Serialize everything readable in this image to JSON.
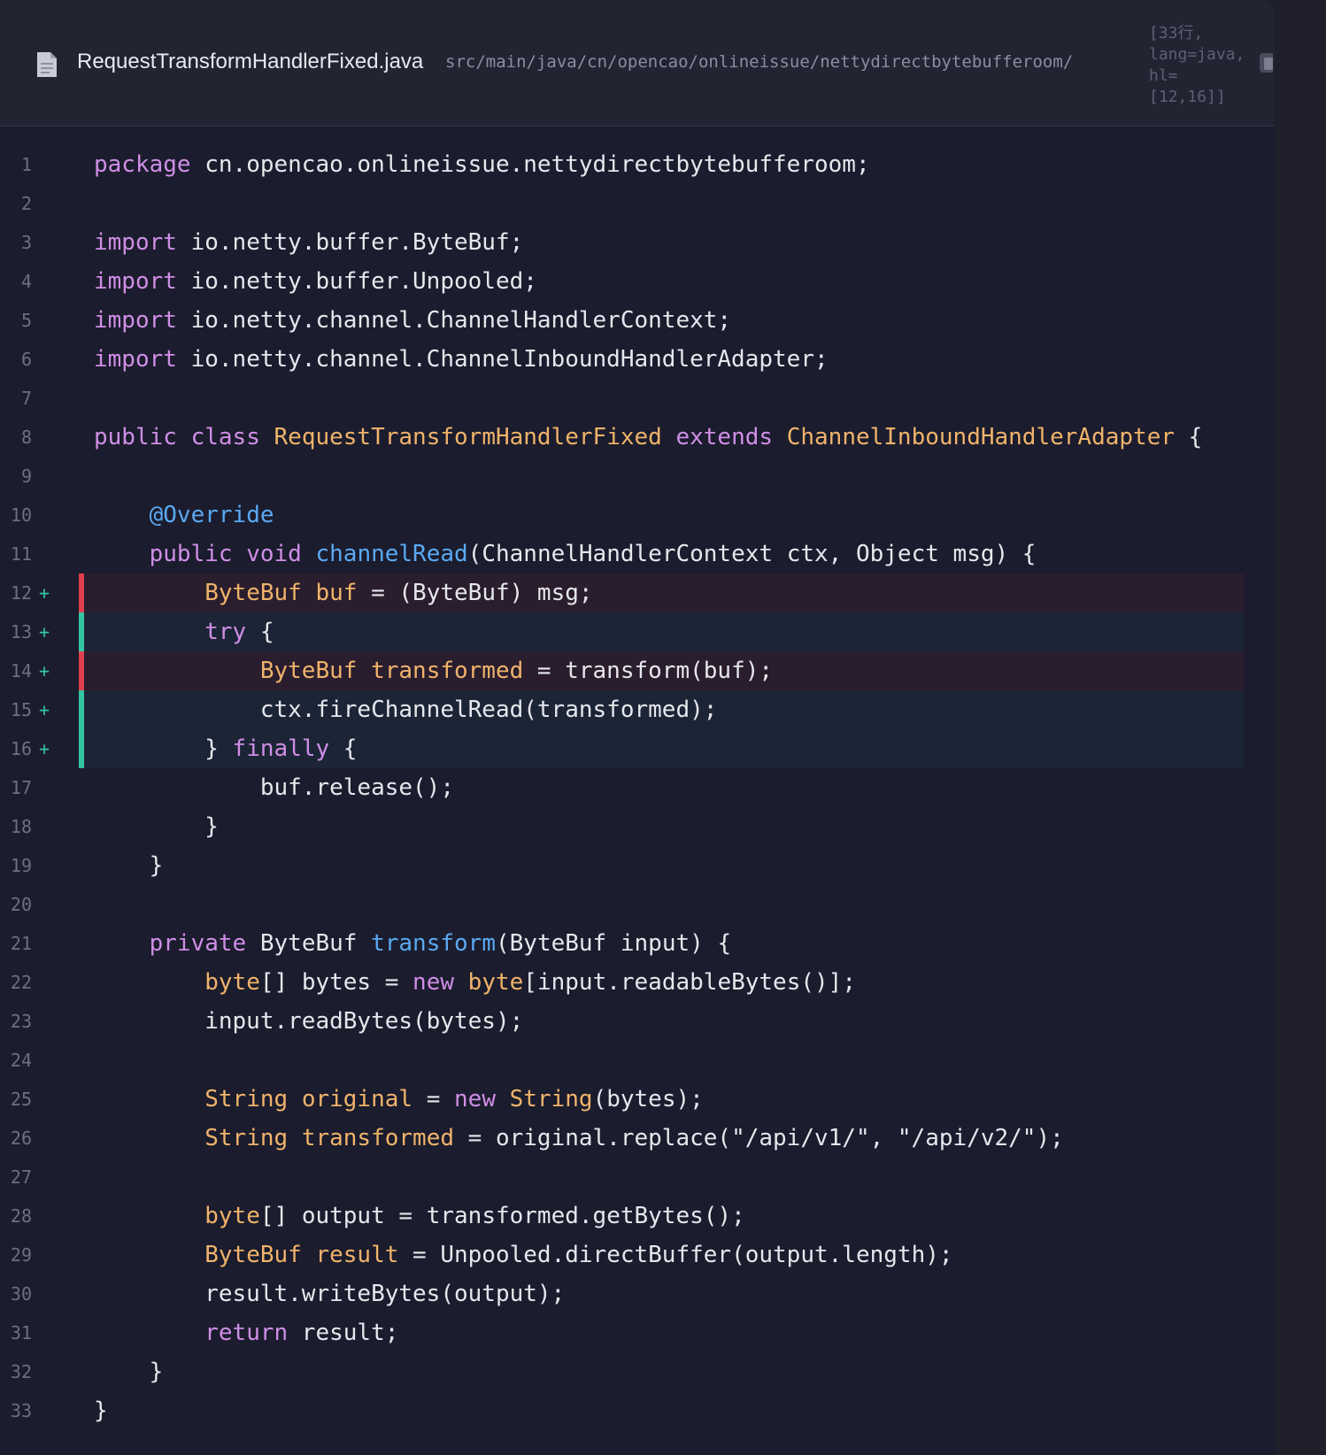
{
  "header": {
    "file_name": "RequestTransformHandlerFixed.java",
    "file_path": "src/main/java/cn/opencao/onlineissue/nettydirectbytebufferoom/",
    "meta": "[33行,\nlang=java,\nhl=\n[12,16]]",
    "file_icon": "document-icon",
    "copy_icon": "copy-icon"
  },
  "colors": {
    "keyword": "#cf8ee6",
    "type": "#f0b36b",
    "function": "#5aa9f2",
    "text": "#e6e7ec",
    "added_red": "#e0404d",
    "added_teal": "#35c4a2"
  },
  "lines": [
    {
      "n": "1",
      "mark": "",
      "hl": "",
      "tokens": [
        [
          "kw",
          "package"
        ],
        [
          "pl",
          " cn.opencao.onlineissue.nettydirectbytebufferoom;"
        ]
      ]
    },
    {
      "n": "2",
      "mark": "",
      "hl": "",
      "tokens": []
    },
    {
      "n": "3",
      "mark": "",
      "hl": "",
      "tokens": [
        [
          "kw",
          "import"
        ],
        [
          "pl",
          " io.netty.buffer.ByteBuf;"
        ]
      ]
    },
    {
      "n": "4",
      "mark": "",
      "hl": "",
      "tokens": [
        [
          "kw",
          "import"
        ],
        [
          "pl",
          " io.netty.buffer.Unpooled;"
        ]
      ]
    },
    {
      "n": "5",
      "mark": "",
      "hl": "",
      "tokens": [
        [
          "kw",
          "import"
        ],
        [
          "pl",
          " io.netty.channel.ChannelHandlerContext;"
        ]
      ]
    },
    {
      "n": "6",
      "mark": "",
      "hl": "",
      "tokens": [
        [
          "kw",
          "import"
        ],
        [
          "pl",
          " io.netty.channel.ChannelInboundHandlerAdapter;"
        ]
      ]
    },
    {
      "n": "7",
      "mark": "",
      "hl": "",
      "tokens": []
    },
    {
      "n": "8",
      "mark": "",
      "hl": "",
      "tokens": [
        [
          "kw",
          "public"
        ],
        [
          "pl",
          " "
        ],
        [
          "kw",
          "class"
        ],
        [
          "pl",
          " "
        ],
        [
          "ty",
          "RequestTransformHandlerFixed"
        ],
        [
          "pl",
          " "
        ],
        [
          "kw",
          "extends"
        ],
        [
          "pl",
          " "
        ],
        [
          "ty",
          "ChannelInboundHandlerAdapter"
        ],
        [
          "pl",
          " {"
        ]
      ]
    },
    {
      "n": "9",
      "mark": "",
      "hl": "",
      "tokens": []
    },
    {
      "n": "10",
      "mark": "",
      "hl": "",
      "tokens": [
        [
          "pl",
          "    "
        ],
        [
          "an",
          "@Override"
        ]
      ]
    },
    {
      "n": "11",
      "mark": "",
      "hl": "",
      "tokens": [
        [
          "pl",
          "    "
        ],
        [
          "kw",
          "public"
        ],
        [
          "pl",
          " "
        ],
        [
          "kw",
          "void"
        ],
        [
          "pl",
          " "
        ],
        [
          "fn",
          "channelRead"
        ],
        [
          "pl",
          "(ChannelHandlerContext ctx, Object msg) {"
        ]
      ]
    },
    {
      "n": "12",
      "mark": "+",
      "hl": "red",
      "tokens": [
        [
          "pl",
          "        "
        ],
        [
          "ty",
          "ByteBuf"
        ],
        [
          "pl",
          " "
        ],
        [
          "ty",
          "buf"
        ],
        [
          "pl",
          " = (ByteBuf) msg;"
        ]
      ]
    },
    {
      "n": "13",
      "mark": "+",
      "hl": "teal",
      "tokens": [
        [
          "pl",
          "        "
        ],
        [
          "kw",
          "try"
        ],
        [
          "pl",
          " {"
        ]
      ]
    },
    {
      "n": "14",
      "mark": "+",
      "hl": "red",
      "tokens": [
        [
          "pl",
          "            "
        ],
        [
          "ty",
          "ByteBuf"
        ],
        [
          "pl",
          " "
        ],
        [
          "ty",
          "transformed"
        ],
        [
          "pl",
          " = transform(buf);"
        ]
      ]
    },
    {
      "n": "15",
      "mark": "+",
      "hl": "teal",
      "tokens": [
        [
          "pl",
          "            ctx.fireChannelRead(transformed);"
        ]
      ]
    },
    {
      "n": "16",
      "mark": "+",
      "hl": "teal",
      "tokens": [
        [
          "pl",
          "        } "
        ],
        [
          "kw",
          "finally"
        ],
        [
          "pl",
          " {"
        ]
      ]
    },
    {
      "n": "17",
      "mark": "",
      "hl": "",
      "tokens": [
        [
          "pl",
          "            buf.release();"
        ]
      ]
    },
    {
      "n": "18",
      "mark": "",
      "hl": "",
      "tokens": [
        [
          "pl",
          "        }"
        ]
      ]
    },
    {
      "n": "19",
      "mark": "",
      "hl": "",
      "tokens": [
        [
          "pl",
          "    }"
        ]
      ]
    },
    {
      "n": "20",
      "mark": "",
      "hl": "",
      "tokens": []
    },
    {
      "n": "21",
      "mark": "",
      "hl": "",
      "tokens": [
        [
          "pl",
          "    "
        ],
        [
          "kw",
          "private"
        ],
        [
          "pl",
          " ByteBuf "
        ],
        [
          "fn",
          "transform"
        ],
        [
          "pl",
          "(ByteBuf input) {"
        ]
      ]
    },
    {
      "n": "22",
      "mark": "",
      "hl": "",
      "tokens": [
        [
          "pl",
          "        "
        ],
        [
          "ty",
          "byte"
        ],
        [
          "pl",
          "[] bytes = "
        ],
        [
          "kw",
          "new"
        ],
        [
          "pl",
          " "
        ],
        [
          "ty",
          "byte"
        ],
        [
          "pl",
          "[input.readableBytes()];"
        ]
      ]
    },
    {
      "n": "23",
      "mark": "",
      "hl": "",
      "tokens": [
        [
          "pl",
          "        input.readBytes(bytes);"
        ]
      ]
    },
    {
      "n": "24",
      "mark": "",
      "hl": "",
      "tokens": []
    },
    {
      "n": "25",
      "mark": "",
      "hl": "",
      "tokens": [
        [
          "pl",
          "        "
        ],
        [
          "ty",
          "String"
        ],
        [
          "pl",
          " "
        ],
        [
          "ty",
          "original"
        ],
        [
          "pl",
          " = "
        ],
        [
          "kw",
          "new"
        ],
        [
          "pl",
          " "
        ],
        [
          "ty",
          "String"
        ],
        [
          "pl",
          "(bytes);"
        ]
      ]
    },
    {
      "n": "26",
      "mark": "",
      "hl": "",
      "tokens": [
        [
          "pl",
          "        "
        ],
        [
          "ty",
          "String"
        ],
        [
          "pl",
          " "
        ],
        [
          "ty",
          "transformed"
        ],
        [
          "pl",
          " = original.replace(\"/api/v1/\", \"/api/v2/\");"
        ]
      ]
    },
    {
      "n": "27",
      "mark": "",
      "hl": "",
      "tokens": []
    },
    {
      "n": "28",
      "mark": "",
      "hl": "",
      "tokens": [
        [
          "pl",
          "        "
        ],
        [
          "ty",
          "byte"
        ],
        [
          "pl",
          "[] output = transformed.getBytes();"
        ]
      ]
    },
    {
      "n": "29",
      "mark": "",
      "hl": "",
      "tokens": [
        [
          "pl",
          "        "
        ],
        [
          "ty",
          "ByteBuf"
        ],
        [
          "pl",
          " "
        ],
        [
          "ty",
          "result"
        ],
        [
          "pl",
          " = Unpooled.directBuffer(output.length);"
        ]
      ]
    },
    {
      "n": "30",
      "mark": "",
      "hl": "",
      "tokens": [
        [
          "pl",
          "        result.writeBytes(output);"
        ]
      ]
    },
    {
      "n": "31",
      "mark": "",
      "hl": "",
      "tokens": [
        [
          "pl",
          "        "
        ],
        [
          "kw",
          "return"
        ],
        [
          "pl",
          " result;"
        ]
      ]
    },
    {
      "n": "32",
      "mark": "",
      "hl": "",
      "tokens": [
        [
          "pl",
          "    }"
        ]
      ]
    },
    {
      "n": "33",
      "mark": "",
      "hl": "",
      "tokens": [
        [
          "pl",
          "}"
        ]
      ]
    }
  ]
}
